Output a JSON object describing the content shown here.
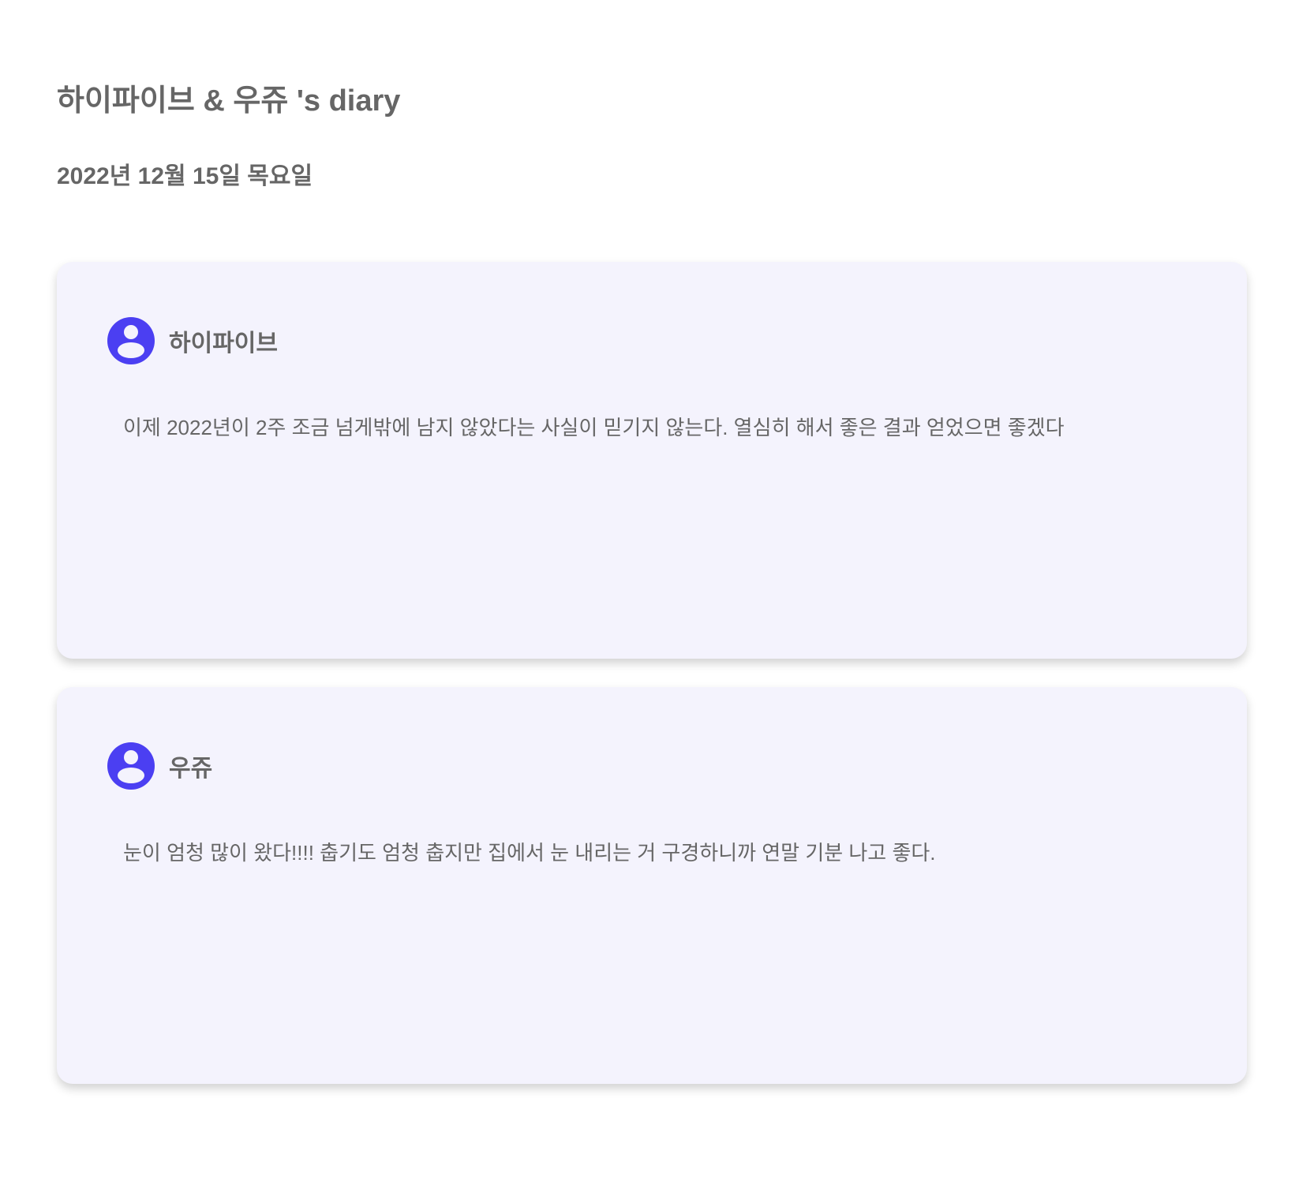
{
  "diary": {
    "title": "하이파이브 & 우쥬 's diary",
    "date": "2022년 12월 15일 목요일"
  },
  "entries": [
    {
      "author": "하이파이브",
      "avatar_icon": "user-circle-icon",
      "text": "이제 2022년이 2주 조금 넘게밖에 남지 않았다는 사실이 믿기지 않는다. 열심히 해서 좋은 결과 얻었으면 좋겠다"
    },
    {
      "author": "우쥬",
      "avatar_icon": "user-circle-icon",
      "text": "눈이 엄청 많이 왔다!!!! 춥기도 엄청 춥지만 집에서 눈 내리는 거 구경하니까 연말 기분 나고 좋다."
    }
  ],
  "colors": {
    "text": "#666666",
    "card_background": "#f4f3fd",
    "avatar_accent": "#4b3ff2"
  }
}
